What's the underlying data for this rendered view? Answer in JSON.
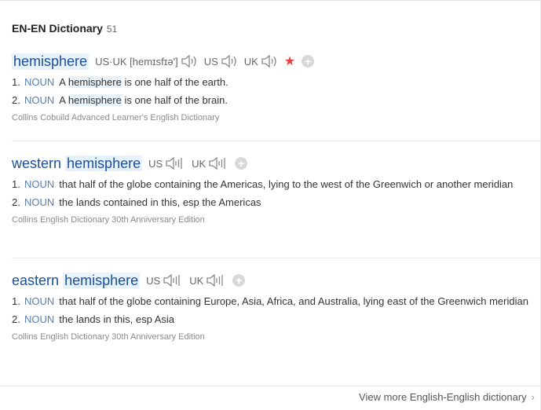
{
  "header": {
    "title": "EN-EN Dictionary",
    "count": "51"
  },
  "entries": [
    {
      "word": "hemisphere",
      "phonetic": "US·UK [hemɪsfɪə']",
      "us_label": "US",
      "uk_label": "UK",
      "favorited": true,
      "definitions": [
        {
          "num": "1.",
          "pos": "NOUN",
          "pre": "A",
          "hl": "hemisphere",
          "post": "is one half of the earth."
        },
        {
          "num": "2.",
          "pos": "NOUN",
          "pre": "A",
          "hl": "hemisphere",
          "post": "is one half of the brain."
        }
      ],
      "source": "Collins Cobuild Advanced Learner's English Dictionary"
    },
    {
      "word_pre": "western",
      "word_hl": "hemisphere",
      "us_label": "US",
      "uk_label": "UK",
      "definitions": [
        {
          "num": "1.",
          "pos": "NOUN",
          "text": "that half of the globe containing the Americas, lying to the west of the Greenwich or another meridian"
        },
        {
          "num": "2.",
          "pos": "NOUN",
          "text": "the lands contained in this, esp the Americas"
        }
      ],
      "source": "Collins English Dictionary 30th Anniversary Edition"
    },
    {
      "word_pre": "eastern",
      "word_hl": "hemisphere",
      "us_label": "US",
      "uk_label": "UK",
      "definitions": [
        {
          "num": "1.",
          "pos": "NOUN",
          "text": "that half of the globe containing Europe, Asia, Africa, and Australia, lying east of the Greenwich meridian"
        },
        {
          "num": "2.",
          "pos": "NOUN",
          "text": "the lands in this, esp Asia"
        }
      ],
      "source": "Collins English Dictionary 30th Anniversary Edition"
    }
  ],
  "footer": {
    "more_label": "View more English-English dictionary",
    "chevron": "›"
  },
  "icons": {
    "speaker": "speaker-icon",
    "star": "star-icon",
    "plus": "add-icon"
  },
  "colors": {
    "word": "#1b4f9c",
    "highlight": "#e7f2fb",
    "star": "#e4413f",
    "pos": "#5a7fb0"
  }
}
